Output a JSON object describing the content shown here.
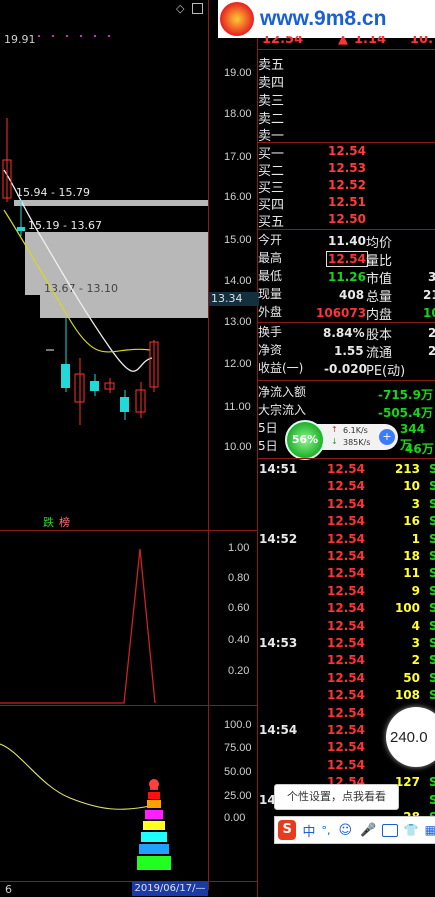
{
  "watermark": {
    "site": "www.9m8.cn"
  },
  "chart_top_price": "19.91",
  "price_axis": [
    "19.00",
    "18.00",
    "17.00",
    "16.00",
    "15.00",
    "14.00",
    "13.00",
    "12.00",
    "11.00",
    "10.00"
  ],
  "current_price_tag": "13.34",
  "zones": [
    {
      "label": "15.94 - 15.79"
    },
    {
      "label": "15.19 - 13.67"
    },
    {
      "label": "13.67 - 13.10"
    }
  ],
  "signal_text_a": "跌",
  "signal_text_b": "榜",
  "indicator1_axis": [
    "1.00",
    "0.80",
    "0.60",
    "0.40",
    "0.20"
  ],
  "indicator2_axis": [
    "100.0",
    "75.00",
    "50.00",
    "25.00",
    "0.00"
  ],
  "date_label": "2019/06/17/—",
  "bottom_left_label": "6",
  "header_quote": {
    "price": "12.54",
    "change": "1.14",
    "extra": "10."
  },
  "order_book": {
    "sell": [
      {
        "label": "卖五"
      },
      {
        "label": "卖四"
      },
      {
        "label": "卖三"
      },
      {
        "label": "卖二"
      },
      {
        "label": "卖一"
      }
    ],
    "buy": [
      {
        "label": "买一",
        "price": "12.54"
      },
      {
        "label": "买二",
        "price": "12.53"
      },
      {
        "label": "买三",
        "price": "12.52"
      },
      {
        "label": "买四",
        "price": "12.51"
      },
      {
        "label": "买五",
        "price": "12.50"
      }
    ]
  },
  "stats": [
    {
      "l1": "今开",
      "v1": "11.40",
      "l2": "均价",
      "v2": ""
    },
    {
      "l1": "最高",
      "v1": "12.54",
      "l2": "量比",
      "v2": ""
    },
    {
      "l1": "最低",
      "v1": "11.26",
      "l2": "市值",
      "v2": "3"
    },
    {
      "l1": "现量",
      "v1": "408",
      "l2": "总量",
      "v2": "21"
    },
    {
      "l1": "外盘",
      "v1": "106073",
      "l2": "内盘",
      "v2": "10"
    },
    {
      "l1": "换手",
      "v1": "8.84%",
      "l2": "股本",
      "v2": "2"
    },
    {
      "l1": "净资",
      "v1": "1.55",
      "l2": "流通",
      "v2": "2"
    },
    {
      "l1": "收益(一)",
      "v1": "-0.020",
      "l2": "PE(动)",
      "v2": ""
    }
  ],
  "flows": [
    {
      "label": "净流入额",
      "value": "-715.9万"
    },
    {
      "label": "大宗流入",
      "value": "-505.4万"
    },
    {
      "label": "5日",
      "value": "344万"
    },
    {
      "label": "5日",
      "value": "46万"
    }
  ],
  "speed_widget": {
    "percent": "56%",
    "up": "6.1K/s",
    "down": "385K/s"
  },
  "ticks": [
    {
      "time": "14:51",
      "price": "12.54",
      "vol": "213",
      "side": "S"
    },
    {
      "time": "",
      "price": "12.54",
      "vol": "10",
      "side": "S"
    },
    {
      "time": "",
      "price": "12.54",
      "vol": "3",
      "side": "S"
    },
    {
      "time": "",
      "price": "12.54",
      "vol": "16",
      "side": "S"
    },
    {
      "time": "14:52",
      "price": "12.54",
      "vol": "1",
      "side": "S"
    },
    {
      "time": "",
      "price": "12.54",
      "vol": "18",
      "side": "S"
    },
    {
      "time": "",
      "price": "12.54",
      "vol": "11",
      "side": "S"
    },
    {
      "time": "",
      "price": "12.54",
      "vol": "9",
      "side": "S"
    },
    {
      "time": "",
      "price": "12.54",
      "vol": "100",
      "side": "S"
    },
    {
      "time": "",
      "price": "12.54",
      "vol": "4",
      "side": "S"
    },
    {
      "time": "14:53",
      "price": "12.54",
      "vol": "3",
      "side": "S"
    },
    {
      "time": "",
      "price": "12.54",
      "vol": "2",
      "side": "S"
    },
    {
      "time": "",
      "price": "12.54",
      "vol": "50",
      "side": "S"
    },
    {
      "time": "",
      "price": "12.54",
      "vol": "108",
      "side": "S"
    },
    {
      "time": "",
      "price": "12.54",
      "vol": "",
      "side": ""
    },
    {
      "time": "14:54",
      "price": "12.54",
      "vol": "",
      "side": ""
    },
    {
      "time": "",
      "price": "12.54",
      "vol": "",
      "side": ""
    },
    {
      "time": "",
      "price": "12.54",
      "vol": "",
      "side": ""
    },
    {
      "time": "",
      "price": "12.54",
      "vol": "127",
      "side": "S"
    },
    {
      "time": "14",
      "price": "12.54",
      "vol": "",
      "side": "S"
    },
    {
      "time": "",
      "price": "",
      "vol": "28",
      "side": "S"
    }
  ],
  "bubble_value": "240.0",
  "tooltip": "个性设置，点我看看",
  "ime_bar": {
    "mode": "中",
    "punct": "°,"
  }
}
